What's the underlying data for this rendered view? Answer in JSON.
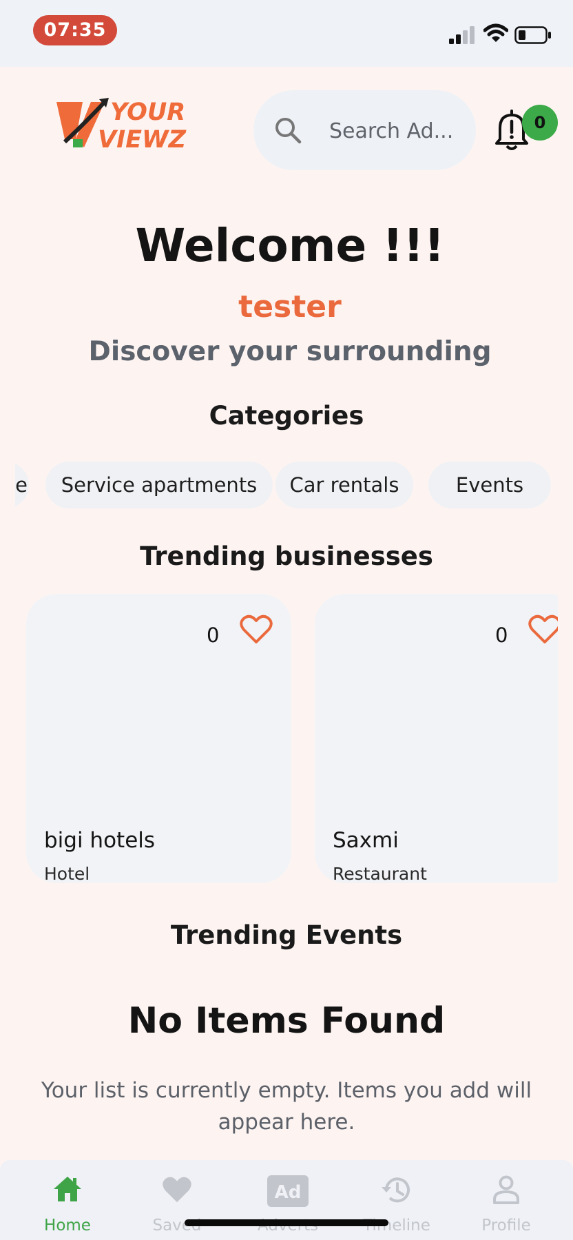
{
  "status": {
    "time": "07:35"
  },
  "header": {
    "logo_line1": "YOUR",
    "logo_line2": "VIEWZ",
    "search_placeholder": "Search Ad...",
    "notification_count": "0"
  },
  "hero": {
    "welcome": "Welcome !!!",
    "username": "tester",
    "tagline": "Discover your surrounding"
  },
  "categories": {
    "title": "Categories",
    "items": [
      "e",
      "Service apartments",
      "Car rentals",
      "Events"
    ]
  },
  "trending_businesses": {
    "title": "Trending businesses",
    "items": [
      {
        "name": "bigi hotels",
        "type": "Hotel",
        "likes": "0"
      },
      {
        "name": "Saxmi",
        "type": "Restaurant",
        "likes": "0"
      }
    ]
  },
  "trending_events": {
    "title": "Trending Events",
    "empty_title": "No Items Found",
    "empty_text": "Your list is currently empty. Items you add will appear here."
  },
  "bottom_nav": {
    "items": [
      "Home",
      "Saved",
      "Adverts",
      "Timeline",
      "Profile"
    ],
    "active": "Home"
  },
  "colors": {
    "accent": "#ea6a3d",
    "active_green": "#3ea447",
    "badge_green": "#3caa48",
    "background": "#fdf4f2"
  }
}
